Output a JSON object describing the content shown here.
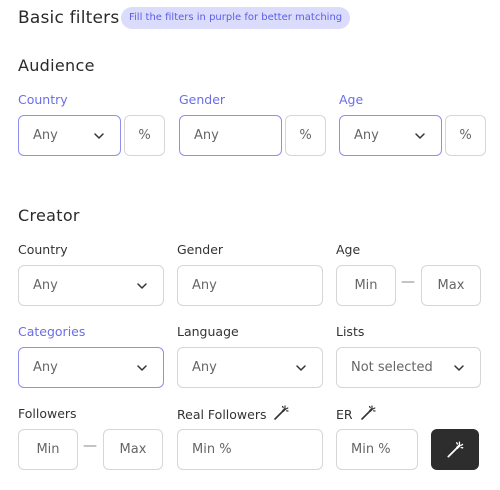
{
  "header": {
    "title": "Basic filters",
    "hint": "Fill the filters in purple for better matching"
  },
  "audience": {
    "heading": "Audience",
    "country": {
      "label": "Country",
      "value": "Any",
      "percent": "%"
    },
    "gender": {
      "label": "Gender",
      "value": "Any",
      "percent": "%"
    },
    "age": {
      "label": "Age",
      "value": "Any",
      "percent": "%"
    }
  },
  "creator": {
    "heading": "Creator",
    "country": {
      "label": "Country",
      "value": "Any"
    },
    "gender": {
      "label": "Gender",
      "value": "Any"
    },
    "age": {
      "label": "Age",
      "min": "Min",
      "max": "Max",
      "dash": "—"
    },
    "categories": {
      "label": "Categories",
      "value": "Any"
    },
    "language": {
      "label": "Language",
      "value": "Any"
    },
    "lists": {
      "label": "Lists",
      "value": "Not selected"
    },
    "followers": {
      "label": "Followers",
      "min": "Min",
      "max": "Max",
      "dash": "—"
    },
    "real_followers": {
      "label": "Real Followers",
      "value": "Min %"
    },
    "er": {
      "label": "ER",
      "value": "Min %"
    }
  },
  "icons": {
    "chevron": "chevron-down-icon",
    "magic": "magic-wand-icon"
  },
  "colors": {
    "accent": "#6a6ee8",
    "pill_bg": "#dbdcfb",
    "dark_button": "#2d2d2d"
  }
}
